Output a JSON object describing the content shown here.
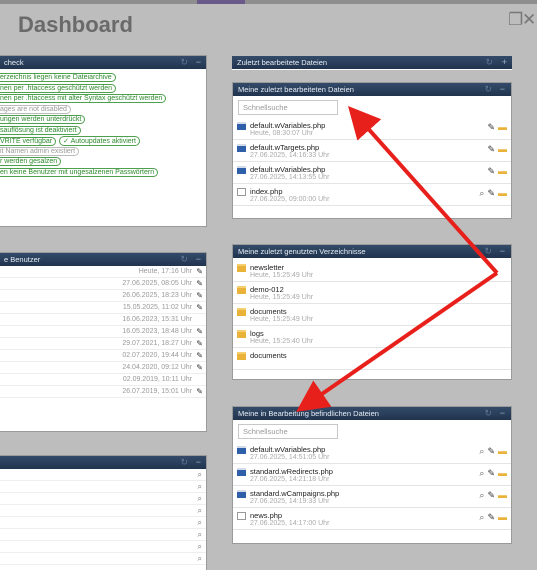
{
  "title": "Dashboard",
  "window": {
    "restore_glyph": "❐",
    "close_glyph": "✕"
  },
  "security_panel": {
    "title": "check",
    "items": [
      {
        "text": "erzeichnis liegen keine Dateiarchive",
        "ok": true
      },
      {
        "text": "nen per .htaccess geschützt werden",
        "ok": true
      },
      {
        "text": "nen per .htaccess mit alter Syntax geschützt werden",
        "ok": true
      },
      {
        "text": "ages are not disabled",
        "ok": false
      },
      {
        "text": "ungen werden unterdrückt",
        "ok": true
      },
      {
        "text": "sauflösung ist deaktiviert",
        "ok": true
      },
      {
        "text": "VRITE verfügbar",
        "ok": true,
        "extra": "✓ Autoupdates aktiviert"
      },
      {
        "text": "it Namen admin existiert",
        "ok": false
      },
      {
        "text": "r werden gesalzen",
        "ok": true
      },
      {
        "text": "en keine Benutzer mit ungesalzenen Passwörtern",
        "ok": true
      }
    ]
  },
  "users_panel": {
    "title": "e Benutzer",
    "rows": [
      {
        "time": "Heute, 17:16 Uhr",
        "edit": true
      },
      {
        "time": "27.06.2025, 08:05 Uhr",
        "edit": true
      },
      {
        "time": "26.06.2025, 18:23 Uhr",
        "edit": true
      },
      {
        "time": "15.05.2025, 11:02 Uhr",
        "edit": true
      },
      {
        "time": "16.06.2023, 15:31 Uhr",
        "edit": false
      },
      {
        "time": "16.05.2023, 18:48 Uhr",
        "edit": true
      },
      {
        "time": "29.07.2021, 18:27 Uhr",
        "edit": true
      },
      {
        "time": "02.07.2020, 19:44 Uhr",
        "edit": true
      },
      {
        "time": "24.04.2020, 09:12 Uhr",
        "edit": true
      },
      {
        "time": "02.09.2019, 10:11 Uhr",
        "edit": false
      },
      {
        "time": "26.07.2019, 15:01 Uhr",
        "edit": true
      }
    ]
  },
  "third_panel": {
    "title": "",
    "row_count": 8
  },
  "recent_files_header": {
    "title": "Zuletzt bearbeitete Dateien"
  },
  "my_recent_files": {
    "title": "Meine zuletzt bearbeiteten Dateien",
    "search_placeholder": "Schnellsuche",
    "files": [
      {
        "name": "default.wVariables.php",
        "date": "Heute, 08:30:07 Uhr",
        "icon": "doc",
        "view": false
      },
      {
        "name": "default.wTargets.php",
        "date": "27.06.2025, 14:16:33 Uhr",
        "icon": "doc",
        "view": false
      },
      {
        "name": "default.wVariables.php",
        "date": "27.06.2025, 14:13:55 Uhr",
        "icon": "doc",
        "view": false
      },
      {
        "name": "index.php",
        "date": "27.06.2025, 09:00:00 Uhr",
        "icon": "page",
        "view": true
      }
    ]
  },
  "my_recent_dirs": {
    "title": "Meine zuletzt genutzten Verzeichnisse",
    "dirs": [
      {
        "name": "newsletter",
        "date": "Heute, 15:25:49 Uhr"
      },
      {
        "name": "demo-012",
        "date": "Heute, 15:25:49 Uhr"
      },
      {
        "name": "documents",
        "date": "Heute, 15:25:49 Uhr"
      },
      {
        "name": "logs",
        "date": "Heute, 15:25:40 Uhr"
      },
      {
        "name": "documents",
        "date": ""
      }
    ]
  },
  "my_editing_files": {
    "title": "Meine in Bearbeitung befindlichen Dateien",
    "search_placeholder": "Schnellsuche",
    "files": [
      {
        "name": "default.wVariables.php",
        "date": "27.06.2025, 14:51:05 Uhr",
        "icon": "doc"
      },
      {
        "name": "standard.wRedirects.php",
        "date": "27.06.2025, 14:21:18 Uhr",
        "icon": "doc"
      },
      {
        "name": "standard.wCampaigns.php",
        "date": "27.06.2025, 14:19:33 Uhr",
        "icon": "doc"
      },
      {
        "name": "news.php",
        "date": "27.06.2025, 14:17:00 Uhr",
        "icon": "page"
      }
    ]
  },
  "glyphs": {
    "minus": "−",
    "plus": "+",
    "refresh": "↻",
    "pencil": "✎",
    "folder": "▬",
    "magnifier": "⌕"
  },
  "colors": {
    "header": "#2a3e5c",
    "annotation_arrow": "#e8201c",
    "ok_badge": "#2c8a2c"
  }
}
